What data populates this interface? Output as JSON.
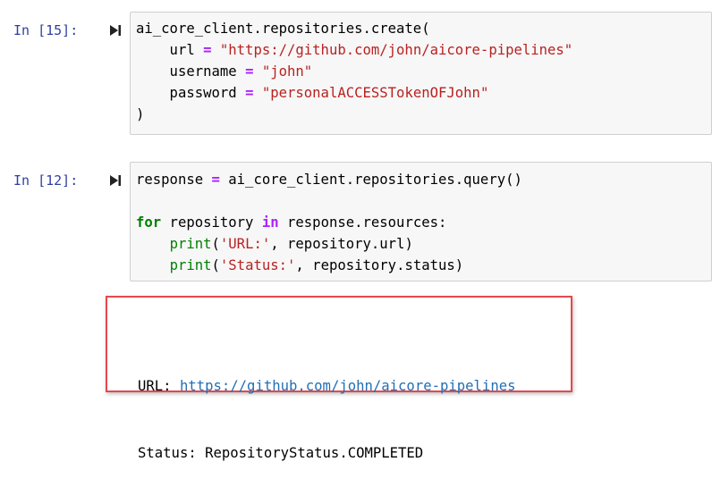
{
  "cells": [
    {
      "prompt": "In [15]:",
      "code_lines": [
        [
          {
            "t": "ai_core_client.repositories.create(",
            "c": ""
          }
        ],
        [
          {
            "t": "    url ",
            "c": ""
          },
          {
            "t": "=",
            "c": "op"
          },
          {
            "t": " ",
            "c": ""
          },
          {
            "t": "\"https://github.com/john/aicore-pipelines\"",
            "c": "str"
          }
        ],
        [
          {
            "t": "    username ",
            "c": ""
          },
          {
            "t": "=",
            "c": "op"
          },
          {
            "t": " ",
            "c": ""
          },
          {
            "t": "\"john\"",
            "c": "str"
          }
        ],
        [
          {
            "t": "    password ",
            "c": ""
          },
          {
            "t": "=",
            "c": "op"
          },
          {
            "t": " ",
            "c": ""
          },
          {
            "t": "\"personalACCESSTokenOFJohn\"",
            "c": "str"
          }
        ],
        [
          {
            "t": ")",
            "c": ""
          }
        ]
      ]
    },
    {
      "prompt": "In [12]:",
      "code_lines": [
        [
          {
            "t": "response ",
            "c": ""
          },
          {
            "t": "=",
            "c": "op"
          },
          {
            "t": " ai_core_client.repositories.query()",
            "c": ""
          }
        ],
        [
          {
            "t": "",
            "c": ""
          }
        ],
        [
          {
            "t": "for",
            "c": "kw"
          },
          {
            "t": " repository ",
            "c": ""
          },
          {
            "t": "in",
            "c": "op"
          },
          {
            "t": " response.resources:",
            "c": ""
          }
        ],
        [
          {
            "t": "    ",
            "c": ""
          },
          {
            "t": "print",
            "c": "fn"
          },
          {
            "t": "(",
            "c": ""
          },
          {
            "t": "'URL:'",
            "c": "str"
          },
          {
            "t": ", repository.url)",
            "c": ""
          }
        ],
        [
          {
            "t": "    ",
            "c": ""
          },
          {
            "t": "print",
            "c": "fn"
          },
          {
            "t": "(",
            "c": ""
          },
          {
            "t": "'Status:'",
            "c": "str"
          },
          {
            "t": ", repository.status)",
            "c": ""
          }
        ]
      ]
    }
  ],
  "output": {
    "url_label": "URL: ",
    "url_value": "https://github.com/john/aicore-pipelines",
    "status_line": "Status: RepositoryStatus.COMPLETED"
  },
  "colors": {
    "prompt": "#303f9f",
    "keyword": "#008000",
    "operator": "#aa22ff",
    "string": "#ba2121",
    "highlight_border": "#e5484d",
    "link": "#1f6fb5"
  },
  "icons": {
    "run": "run-cell-icon"
  }
}
